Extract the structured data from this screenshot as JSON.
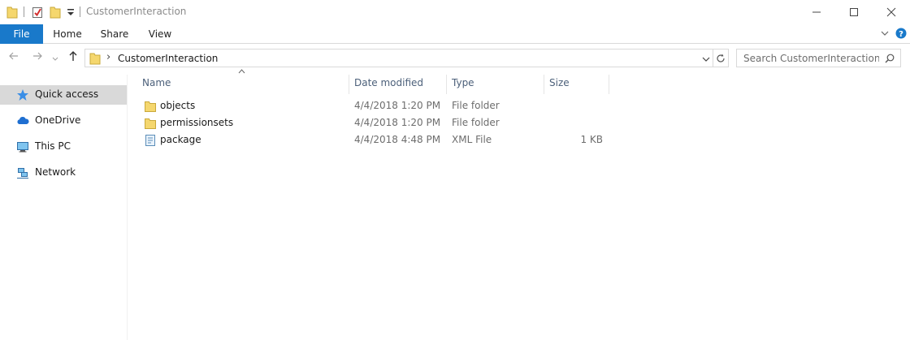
{
  "window": {
    "title": "CustomerInteraction"
  },
  "ribbon": {
    "tabs": [
      {
        "label": "File",
        "active": true
      },
      {
        "label": "Home"
      },
      {
        "label": "Share"
      },
      {
        "label": "View"
      }
    ]
  },
  "address": {
    "breadcrumb_separator": "›",
    "path": "CustomerInteraction"
  },
  "search": {
    "placeholder": "Search CustomerInteraction"
  },
  "sidebar": {
    "items": [
      {
        "label": "Quick access",
        "icon": "star-icon",
        "selected": true
      },
      {
        "label": "OneDrive",
        "icon": "cloud-icon"
      },
      {
        "label": "This PC",
        "icon": "computer-icon"
      },
      {
        "label": "Network",
        "icon": "network-icon"
      }
    ]
  },
  "columns": [
    "Name",
    "Date modified",
    "Type",
    "Size"
  ],
  "files": [
    {
      "name": "objects",
      "date": "4/4/2018 1:20 PM",
      "type": "File folder",
      "size": "",
      "icon": "folder-icon"
    },
    {
      "name": "permissionsets",
      "date": "4/4/2018 1:20 PM",
      "type": "File folder",
      "size": "",
      "icon": "folder-icon"
    },
    {
      "name": "package",
      "date": "4/4/2018 4:48 PM",
      "type": "XML File",
      "size": "1 KB",
      "icon": "xml-file-icon"
    }
  ],
  "colors": {
    "file_tab": "#1979ca",
    "folder": "#f5d76e",
    "selected_nav": "#d9d9d9",
    "column_header_text": "#4c607a"
  }
}
